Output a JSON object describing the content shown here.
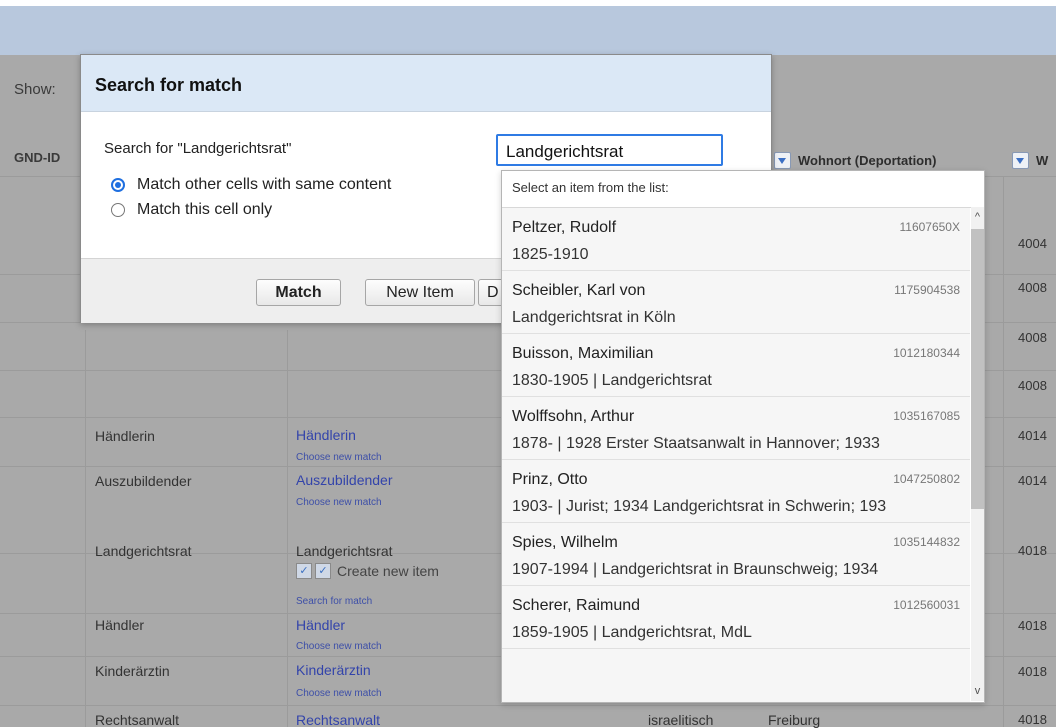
{
  "background": {
    "show_label": "Show:",
    "gnd_id_header": "GND-ID",
    "wohnort_header": "Wohnort (Deportation)",
    "next_header_fragment": "W",
    "rows": [
      {
        "col1": "Händlerin",
        "link": "Händlerin",
        "sub": "Choose new match",
        "num": "4014"
      },
      {
        "col1": "Auszubildender",
        "link": "Auszubildender",
        "sub": "Choose new match",
        "num": "4014"
      },
      {
        "col1": "Landgerichtsrat",
        "text": "Landgerichtsrat",
        "create_label": "Create new item",
        "sub": "Search for match",
        "num": "4018"
      },
      {
        "col1": "Händler",
        "link": "Händler",
        "sub": "Choose new match",
        "num": "4018"
      },
      {
        "col1": "Kinderärztin",
        "link": "Kinderärztin",
        "sub": "Choose new match",
        "num": "4018"
      },
      {
        "col1": "Rechtsanwalt",
        "link": "Rechtsanwalt",
        "religion": "israelitisch",
        "city": "Freiburg",
        "num": "4018"
      }
    ],
    "upper_nums": [
      "4004",
      "4008",
      "4008",
      "4008"
    ]
  },
  "dialog": {
    "title": "Search for match",
    "search_label": "Search for \"Landgerichtsrat\"",
    "search_value": "Landgerichtsrat",
    "radio_same": "Match other cells with same content",
    "radio_same_checked": true,
    "radio_this": "Match this cell only",
    "match_button": "Match",
    "new_item_button": "New Item",
    "dont_button_fragment": "D"
  },
  "suggest": {
    "status": "Select an item from the list:",
    "items": [
      {
        "name": "Peltzer, Rudolf",
        "id": "11607650X",
        "desc": "1825-1910"
      },
      {
        "name": "Scheibler, Karl von",
        "id": "1175904538",
        "desc": "Landgerichtsrat in Köln"
      },
      {
        "name": "Buisson, Maximilian",
        "id": "1012180344",
        "desc": "1830-1905 | Landgerichtsrat"
      },
      {
        "name": "Wolffsohn, Arthur",
        "id": "1035167085",
        "desc": "1878- | 1928 Erster Staatsanwalt in Hannover; 1933"
      },
      {
        "name": "Prinz, Otto",
        "id": "1047250802",
        "desc": "1903- | Jurist; 1934 Landgerichtsrat in Schwerin; 193"
      },
      {
        "name": "Spies, Wilhelm",
        "id": "1035144832",
        "desc": "1907-1994 | Landgerichtsrat in Braunschweig; 1934"
      },
      {
        "name": "Scherer, Raimund",
        "id": "1012560031",
        "desc": "1859-1905 | Landgerichtsrat, MdL"
      }
    ]
  }
}
